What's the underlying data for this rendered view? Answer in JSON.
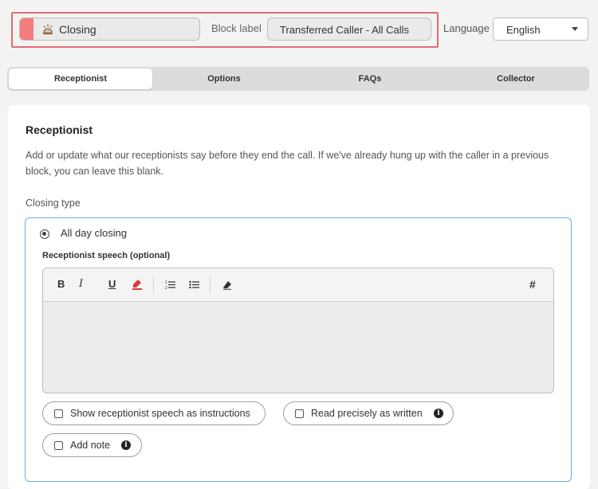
{
  "header": {
    "block_type": "Closing",
    "block_label_caption": "Block label",
    "block_label_value": "Transferred Caller - All Calls",
    "language_caption": "Language",
    "language_value": "English",
    "block_type_color": "#f47c7c",
    "highlight_color": "#e06c75"
  },
  "tabs": [
    {
      "label": "Receptionist",
      "active": true
    },
    {
      "label": "Options",
      "active": false
    },
    {
      "label": "FAQs",
      "active": false
    },
    {
      "label": "Collector",
      "active": false
    }
  ],
  "section": {
    "title": "Receptionist",
    "description": "Add or update what our receptionists say before they end the call. If we've already hung up with the caller in a previous block, you can leave this blank.",
    "closing_type_label": "Closing type"
  },
  "closing_option": {
    "label": "All day closing",
    "selected": true,
    "speech_label": "Receptionist speech (optional)",
    "editor_value": "",
    "toolbar": {
      "bold": "B",
      "italic": "I",
      "underline": "U",
      "variable": "#",
      "icons": [
        "bold-icon",
        "italic-icon",
        "underline-icon",
        "highlight-icon",
        "ordered-list-icon",
        "bullet-list-icon",
        "clear-format-icon",
        "variable-icon"
      ]
    },
    "checkboxes": [
      {
        "label": "Show receptionist speech as instructions",
        "checked": false,
        "info": false
      },
      {
        "label": "Read precisely as written",
        "checked": false,
        "info": true
      },
      {
        "label": "Add note",
        "checked": false,
        "info": true
      }
    ]
  },
  "accent_color": "#6aaee8"
}
